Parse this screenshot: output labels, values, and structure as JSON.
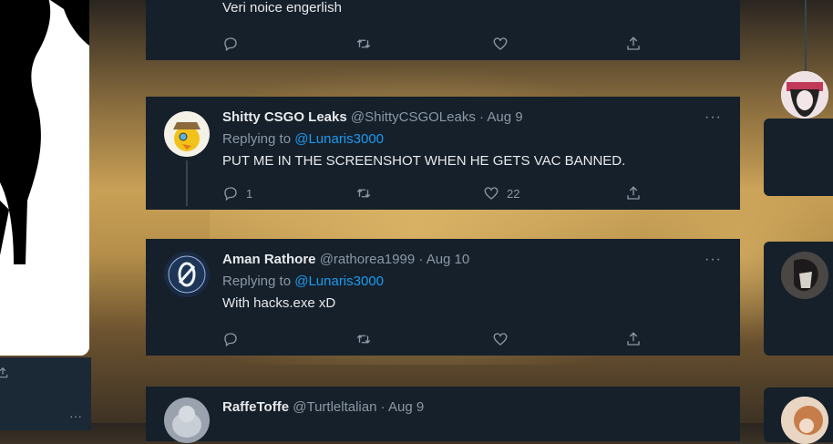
{
  "top_tweet": {
    "text": "Veri noice engerlish"
  },
  "tweets": [
    {
      "name": "Shitty CSGO Leaks",
      "handle": "@ShittyCSGOLeaks",
      "date": "Aug 9",
      "replying_label": "Replying to",
      "replying_to": "@Lunaris3000",
      "text": "PUT ME IN THE SCREENSHOT WHEN HE GETS VAC BANNED.",
      "reply_count": "1",
      "retweet_count": "",
      "like_count": "22",
      "more": "···"
    },
    {
      "name": "Aman Rathore",
      "handle": "@rathorea1999",
      "date": "Aug 10",
      "replying_label": "Replying to",
      "replying_to": "@Lunaris3000",
      "text": "With hacks.exe xD",
      "reply_count": "",
      "retweet_count": "",
      "like_count": "",
      "more": "···"
    },
    {
      "name": "RaffeToffe",
      "handle": "@Turtleltalian",
      "date": "Aug 9"
    }
  ],
  "separator": "·",
  "icons": [
    "reply-icon",
    "retweet-icon",
    "like-icon",
    "share-icon",
    "more-icon"
  ],
  "colors": {
    "card_bg": "#15202b",
    "text": "#e7e9ea",
    "muted": "#8b98a5",
    "link": "#1d9bf0"
  },
  "left_dots": "···"
}
